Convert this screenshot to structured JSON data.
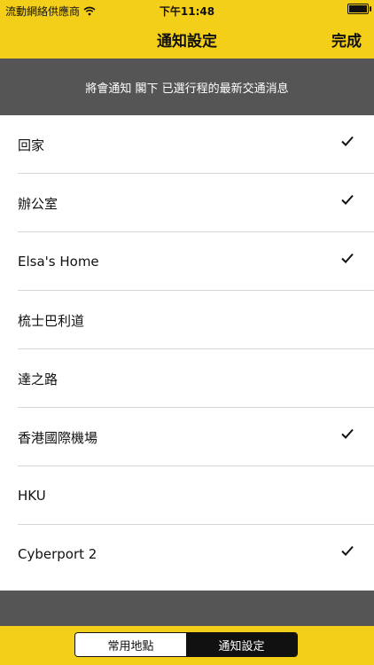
{
  "status_bar": {
    "carrier": "流動網絡供應商",
    "time": "下午11:48",
    "battery_level": 1.0
  },
  "nav": {
    "title": "通知設定",
    "done_label": "完成"
  },
  "banner": {
    "text": "將會通知 閣下 已選行程的最新交通消息"
  },
  "locations": [
    {
      "label": "回家",
      "checked": true
    },
    {
      "label": "辦公室",
      "checked": true
    },
    {
      "label": "Elsa's Home",
      "checked": true
    },
    {
      "label": "梳士巴利道",
      "checked": false
    },
    {
      "label": "達之路",
      "checked": false
    },
    {
      "label": "香港國際機場",
      "checked": true
    },
    {
      "label": "HKU",
      "checked": false
    },
    {
      "label": "Cyberport 2",
      "checked": true
    }
  ],
  "tabs": {
    "favorites_label": "常用地點",
    "notifications_label": "通知設定",
    "active": "notifications"
  },
  "colors": {
    "accent": "#f4cf1a",
    "banner": "#555555",
    "separator": "#d6d6d6"
  },
  "icons": {
    "checkmark": "check-icon",
    "wifi": "wifi-icon",
    "battery": "battery-icon"
  }
}
